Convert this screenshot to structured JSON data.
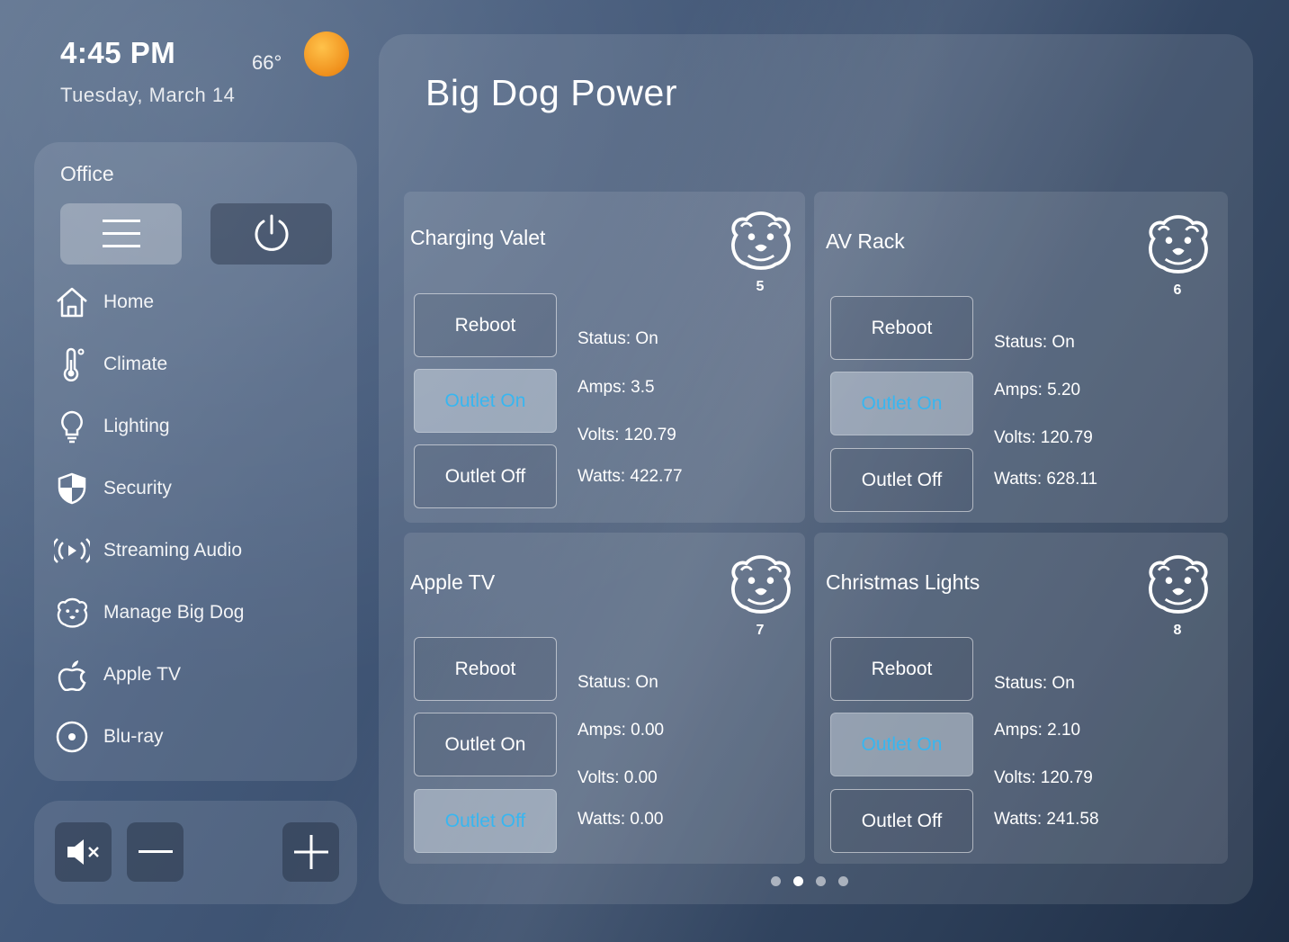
{
  "header": {
    "time": "4:45 PM",
    "date": "Tuesday,  March  14",
    "temperature": "66°",
    "weather_icon": "sun-icon"
  },
  "sidebar": {
    "room": "Office",
    "menu_icon": "hamburger-menu-icon",
    "power_icon": "power-icon",
    "items": [
      {
        "label": "Home",
        "icon": "home-icon"
      },
      {
        "label": "Climate",
        "icon": "thermometer-icon"
      },
      {
        "label": "Lighting",
        "icon": "lightbulb-icon"
      },
      {
        "label": "Security",
        "icon": "shield-icon"
      },
      {
        "label": "Streaming Audio",
        "icon": "broadcast-icon"
      },
      {
        "label": "Manage Big Dog",
        "icon": "bulldog-icon"
      },
      {
        "label": "Apple TV",
        "icon": "apple-icon"
      },
      {
        "label": "Blu-ray",
        "icon": "disc-icon"
      }
    ]
  },
  "volume": {
    "mute_icon": "mute-icon",
    "down_icon": "minus-icon",
    "up_icon": "plus-icon"
  },
  "main": {
    "title": "Big Dog Power",
    "cards": [
      {
        "name": "Charging Valet",
        "number": "5",
        "reboot": "Reboot",
        "outlet_on": "Outlet On",
        "outlet_off": "Outlet Off",
        "active": "on",
        "status": "Status: On",
        "amps": "Amps: 3.5",
        "volts": "Volts: 120.79",
        "watts": "Watts: 422.77"
      },
      {
        "name": "AV Rack",
        "number": "6",
        "reboot": "Reboot",
        "outlet_on": "Outlet On",
        "outlet_off": "Outlet Off",
        "active": "on",
        "status": "Status:  On",
        "amps": "Amps:  5.20",
        "volts": "Volts:  120.79",
        "watts": "Watts:  628.11"
      },
      {
        "name": "Apple TV",
        "number": "7",
        "reboot": "Reboot",
        "outlet_on": "Outlet On",
        "outlet_off": "Outlet Off",
        "active": "off",
        "status": "Status:  On",
        "amps": "Amps:  0.00",
        "volts": "Volts:  0.00",
        "watts": "Watts:  0.00"
      },
      {
        "name": "Christmas Lights",
        "number": "8",
        "reboot": "Reboot",
        "outlet_on": "Outlet On",
        "outlet_off": "Outlet Off",
        "active": "on",
        "status": "Status:  On",
        "amps": "Amps: 2.10",
        "volts": "Volts:  120.79",
        "watts": "Watts:  241.58"
      }
    ],
    "pagination": {
      "pages": 4,
      "current": 2
    }
  },
  "colors": {
    "active_text": "#38b6f0",
    "sun": "#f0901c"
  }
}
